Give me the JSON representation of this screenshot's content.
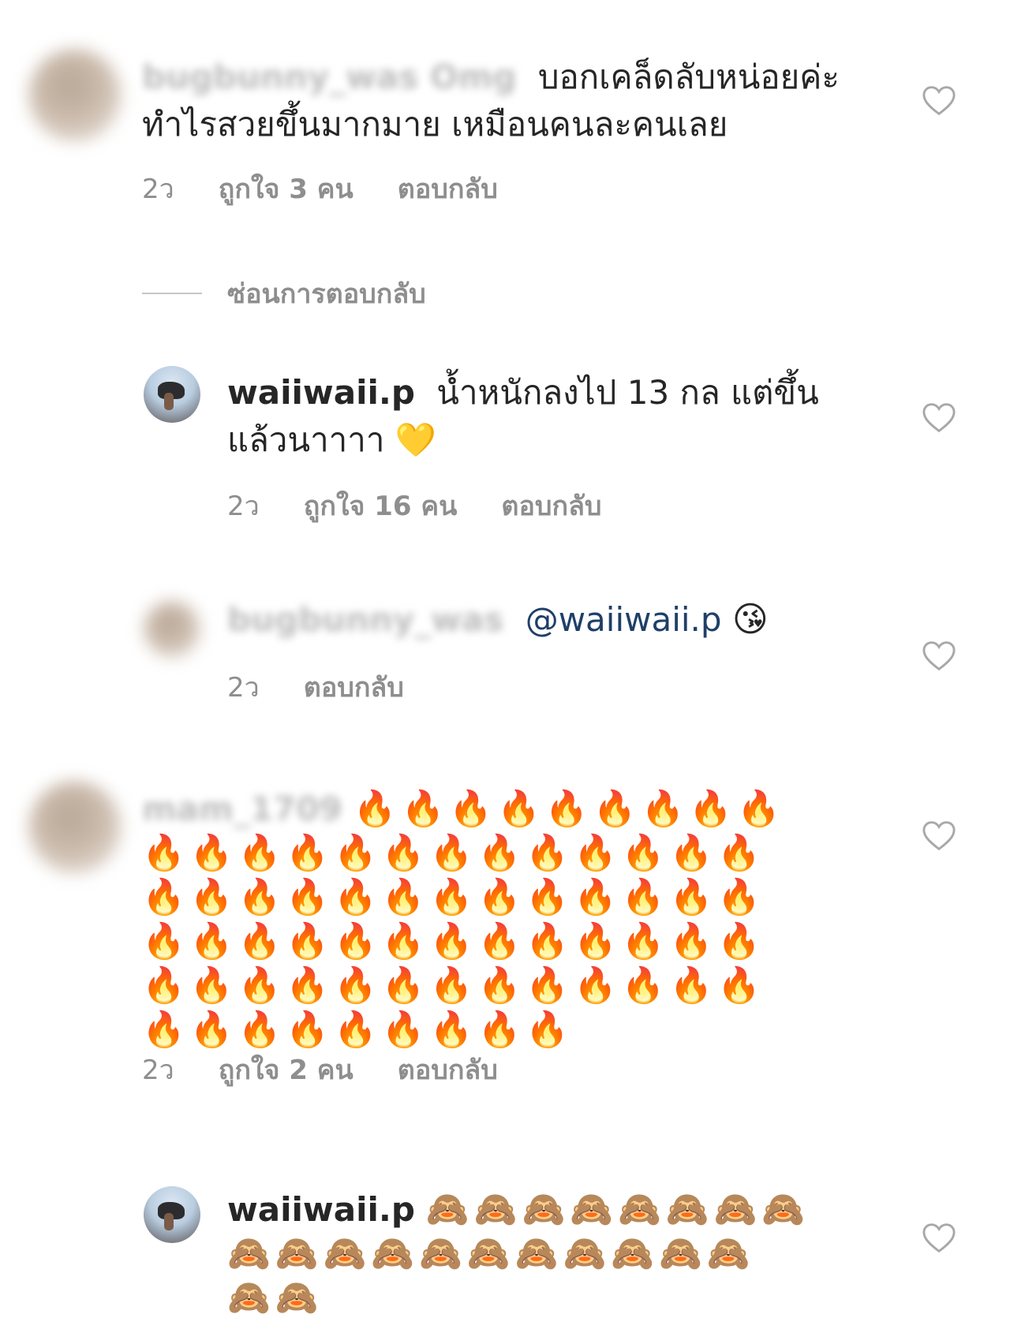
{
  "comments": [
    {
      "username": "bugbunny_was Omg",
      "text": "บอกเคล็ดลับหน่อยค่ะ ทำไรสวยขึ้นมากมาย เหมือนคนละคนเลย",
      "time": "2ว",
      "likes": "ถูกใจ 3 คน",
      "reply": "ตอบกลับ"
    },
    {
      "username": "waiiwaii.p",
      "text": "น้ำหนักลงไป 13 กล แต่ขึ้นแล้วนาาาา 💛",
      "time": "2ว",
      "likes": "ถูกใจ 16 คน",
      "reply": "ตอบกลับ"
    },
    {
      "username": "bugbunny_was",
      "mention": "@waiiwaii.p",
      "emoji": "😘",
      "time": "2ว",
      "reply": "ตอบกลับ"
    },
    {
      "username": "mam_1709",
      "emoji_line1": "🔥🔥🔥🔥🔥🔥🔥🔥🔥",
      "emoji_line2": "🔥🔥🔥🔥🔥🔥🔥🔥🔥🔥🔥🔥🔥",
      "emoji_line3": "🔥🔥🔥🔥🔥🔥🔥🔥🔥🔥🔥🔥🔥",
      "emoji_line4": "🔥🔥🔥🔥🔥🔥🔥🔥🔥🔥🔥🔥🔥",
      "emoji_line5": "🔥🔥🔥🔥🔥🔥🔥🔥🔥🔥🔥🔥🔥",
      "emoji_line6": "🔥🔥🔥🔥🔥🔥🔥🔥🔥",
      "time": "2ว",
      "likes": "ถูกใจ 2 คน",
      "reply": "ตอบกลับ"
    },
    {
      "username": "waiiwaii.p",
      "emoji_line1": "🙈🙈🙈🙈🙈🙈🙈🙈",
      "emoji_line2": "🙈🙈🙈🙈🙈🙈🙈🙈🙈🙈🙈",
      "emoji_line3": "🙈🙈"
    }
  ],
  "hide_replies": "ซ่อนการตอบกลับ",
  "icons": {
    "like": "heart-outline-icon"
  }
}
